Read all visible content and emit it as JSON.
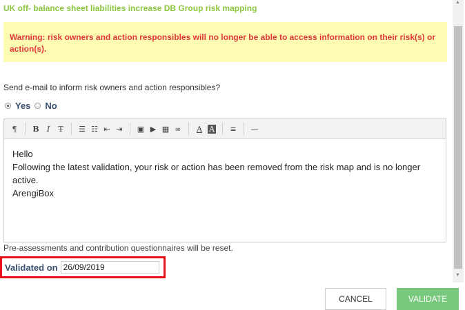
{
  "title": "UK off- balance sheet liabilities increase DB Group risk mapping",
  "warning": "Warning: risk owners and action responsibles will no longer be able to access information on their risk(s) or action(s).",
  "send_email_label": "Send e-mail to inform risk owners and action responsibles?",
  "radio": {
    "yes_label": "Yes",
    "no_label": "No",
    "selected": "Yes"
  },
  "toolbar": {
    "paragraph": "¶",
    "bold": "B",
    "italic": "I",
    "strike": "T̶",
    "ul": "☰",
    "ol": "☷",
    "outdent": "⇤",
    "indent": "⇥",
    "image": "▣",
    "video": "▶",
    "table": "▦",
    "link": "∞",
    "font_color": "A",
    "bg_color": "A",
    "align": "≡",
    "hr": "—"
  },
  "editor": {
    "line1": "Hello",
    "line2": "Following the latest validation, your risk or action has been removed from the risk map and is no longer active.",
    "line3": "ArengiBox"
  },
  "reset_note": "Pre-assessments and contribution questionnaires will be reset.",
  "validated": {
    "label": "Validated on",
    "value": "26/09/2019"
  },
  "buttons": {
    "cancel": "CANCEL",
    "validate": "VALIDATE"
  },
  "colors": {
    "title": "#8cc63f",
    "warning_bg": "#fdfcb2",
    "warning_text": "#e0373a",
    "validate_bg": "#78c97d",
    "highlight_border": "#e8101a"
  }
}
